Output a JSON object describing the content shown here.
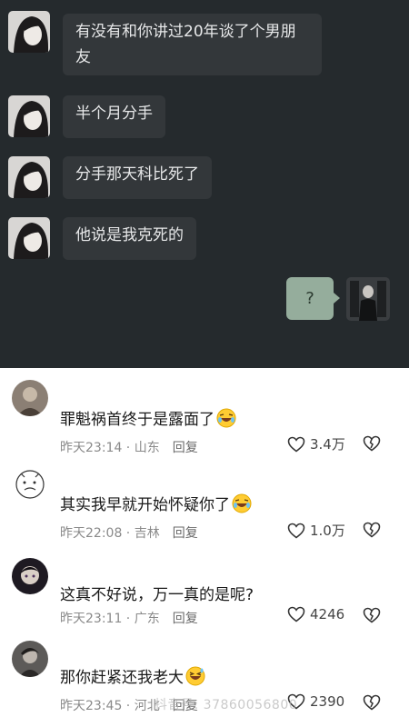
{
  "chat": {
    "messages": [
      {
        "text": "有没有和你讲过20年谈了个男朋友"
      },
      {
        "text": "半个月分手"
      },
      {
        "text": "分手那天科比死了"
      },
      {
        "text": "他说是我克死的"
      }
    ],
    "my_reply": "?",
    "colors": {
      "background": "#252a2d",
      "bubble": "#33373a",
      "my_bubble": "#95ad9c"
    }
  },
  "comments": [
    {
      "text": "罪魁祸首终于是露面了",
      "emoji": "laughing-crying-emoji",
      "time": "昨天23:14",
      "location": "山东",
      "reply_label": "回复",
      "likes": "3.4万"
    },
    {
      "text": "其实我早就开始怀疑你了",
      "emoji": "laughing-crying-emoji",
      "time": "昨天22:08",
      "location": "吉林",
      "reply_label": "回复",
      "likes": "1.0万"
    },
    {
      "text": "这真不好说，万一真的是呢?",
      "emoji": "",
      "time": "昨天23:11",
      "location": "广东",
      "reply_label": "回复",
      "likes": "4246"
    },
    {
      "text": "那你赶紧还我老大",
      "emoji": "grinning-sweat-emoji",
      "time": "昨天23:45",
      "location": "河北",
      "reply_label": "回复",
      "likes": "2390"
    }
  ],
  "watermark": "抖音号: 37860056800"
}
